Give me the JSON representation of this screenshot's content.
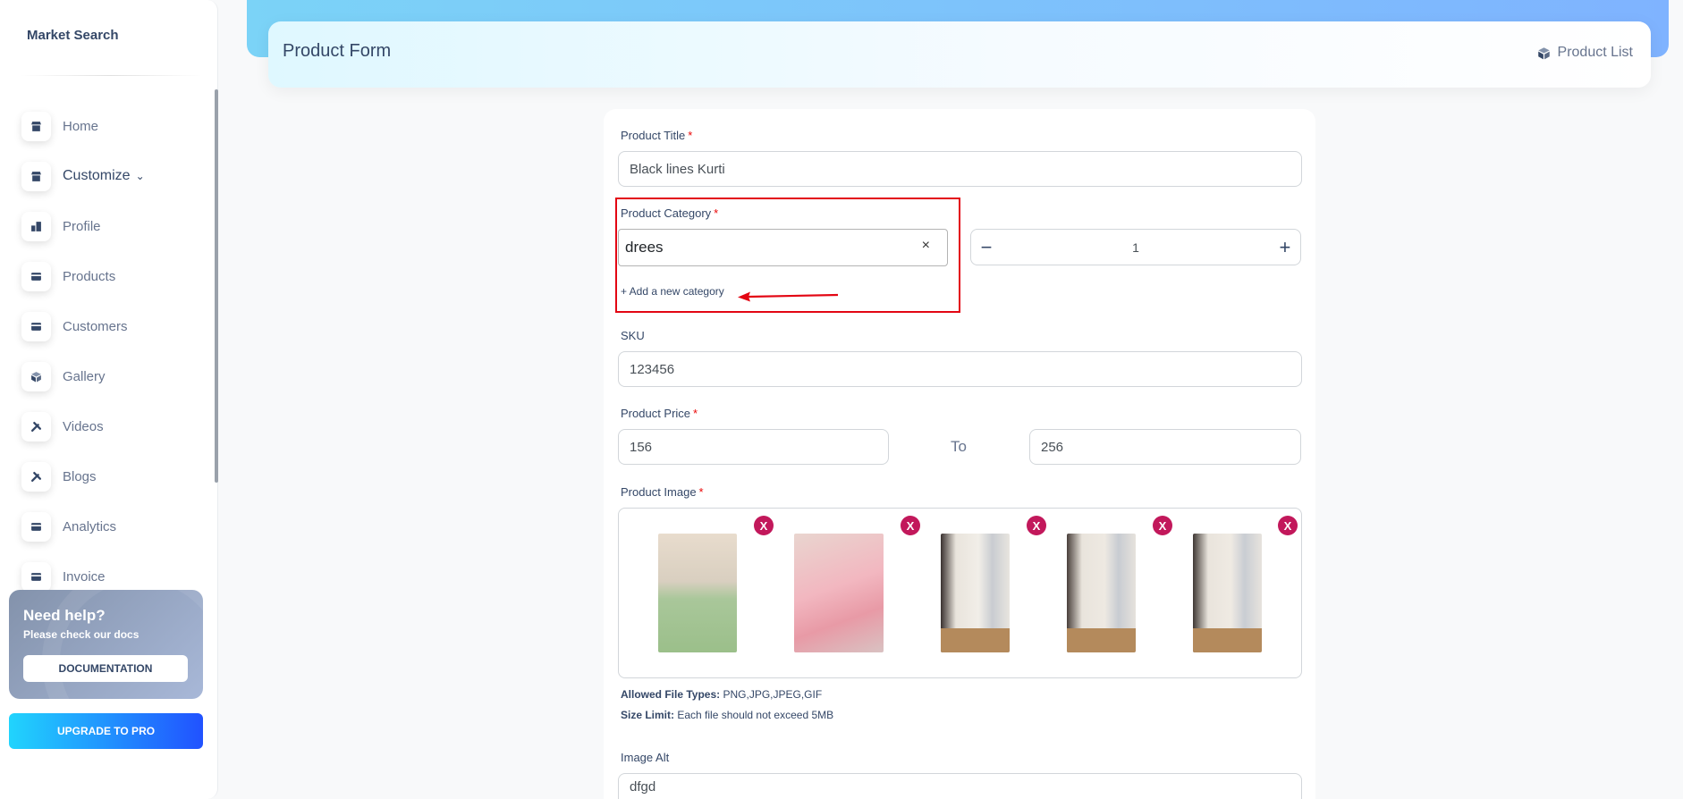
{
  "sidebar": {
    "brand": "Market Search",
    "items": [
      {
        "label": "Home"
      },
      {
        "label": "Customize"
      },
      {
        "label": "Profile"
      },
      {
        "label": "Products"
      },
      {
        "label": "Customers"
      },
      {
        "label": "Gallery"
      },
      {
        "label": "Videos"
      },
      {
        "label": "Blogs"
      },
      {
        "label": "Analytics"
      },
      {
        "label": "Invoice"
      }
    ],
    "help": {
      "title": "Need help?",
      "subtitle": "Please check our docs",
      "button": "DOCUMENTATION"
    },
    "upgrade": "UPGRADE TO PRO"
  },
  "header": {
    "title": "Product Form",
    "link": "Product List"
  },
  "form": {
    "title_label": "Product Title",
    "title_value": "Black lines Kurti",
    "category_label": "Product Category",
    "category_value": "drees",
    "category_clear": "×",
    "add_category": "+ Add a new category",
    "quantity": "1",
    "sku_label": "SKU",
    "sku_value": "123456",
    "price_label": "Product Price",
    "price_from": "156",
    "price_to_text": "To",
    "price_to": "256",
    "image_label": "Product Image",
    "delete_label": "X",
    "file_types_label": "Allowed File Types:",
    "file_types_value": "PNG,JPG,JPEG,GIF",
    "size_label": "Size Limit:",
    "size_value": "Each file should not exceed 5MB",
    "alt_label": "Image Alt",
    "alt_value": "dfgd",
    "required_mark": "*"
  },
  "colors": {
    "accent_red": "#e30613",
    "delete_button": "#c2185b",
    "text_dark": "#344767"
  }
}
